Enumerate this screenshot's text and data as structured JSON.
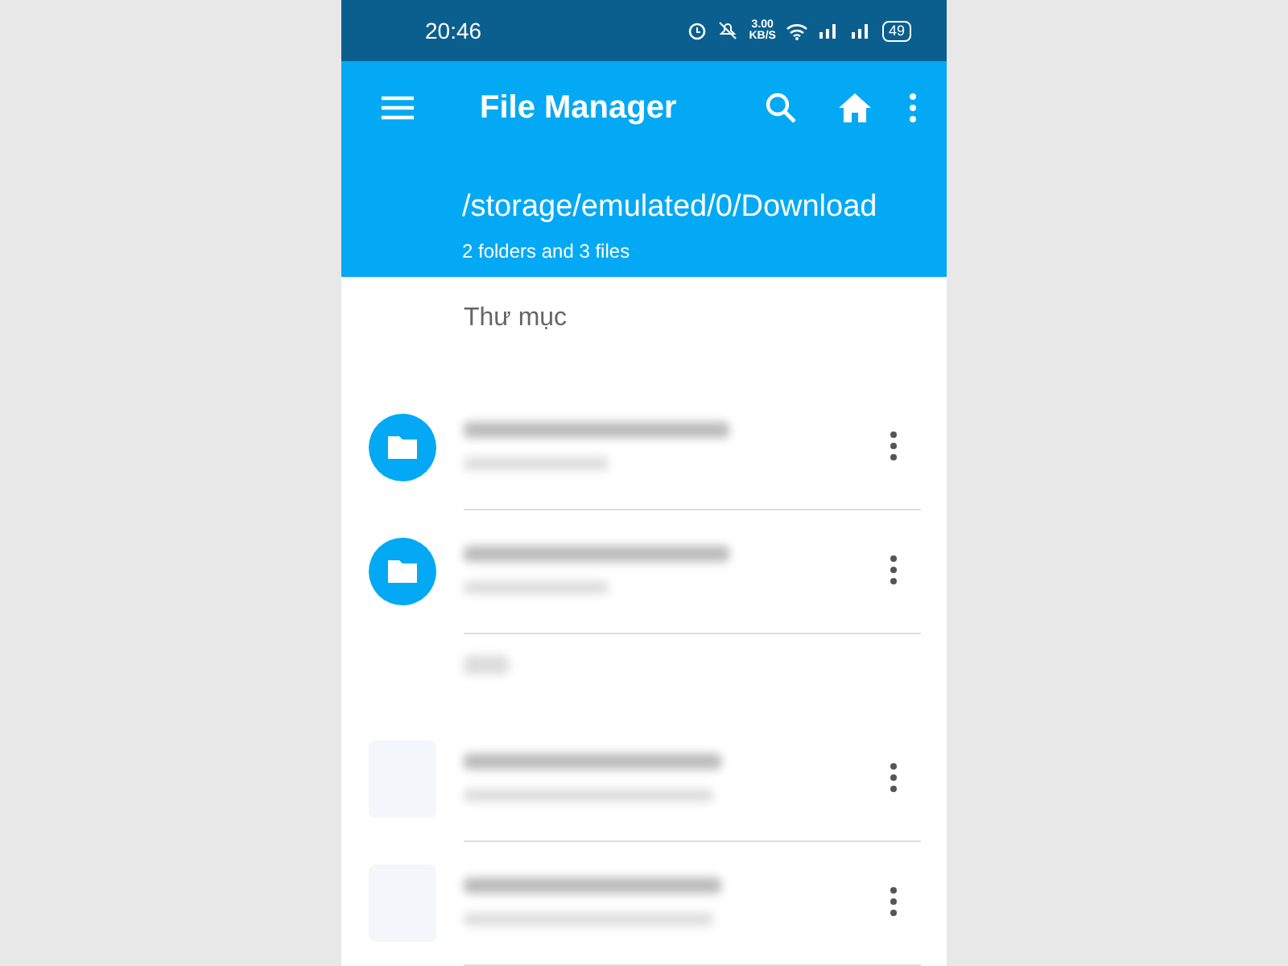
{
  "status_bar": {
    "time": "20:46",
    "speed": "3.00",
    "speed_unit": "KB/S",
    "battery": "49"
  },
  "toolbar": {
    "title": "File Manager"
  },
  "path": {
    "location": "/storage/emulated/0/Download",
    "summary": "2 folders and 3 files"
  },
  "sections": [
    {
      "kind": "heading",
      "title": "Thư mục"
    },
    {
      "kind": "folder"
    },
    {
      "kind": "folder"
    },
    {
      "kind": "blurred-heading"
    },
    {
      "kind": "image"
    },
    {
      "kind": "image"
    }
  ]
}
